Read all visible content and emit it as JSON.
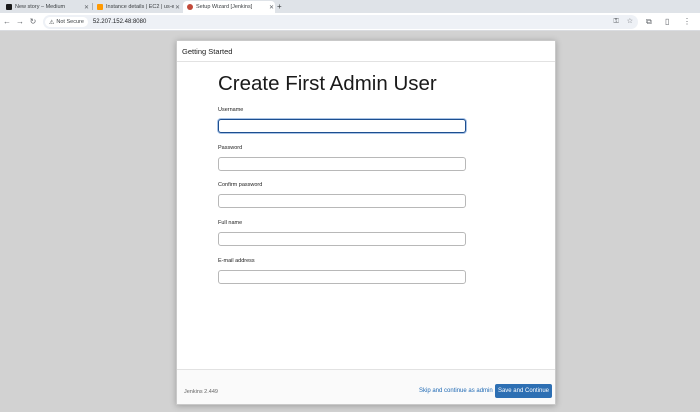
{
  "browser": {
    "tabs": [
      {
        "title": "New story – Medium",
        "favicon_color": "#1a1a1a",
        "active": false
      },
      {
        "title": "Instance details | EC2 | us-e…",
        "favicon_color": "#ff9900",
        "active": false
      },
      {
        "title": "Setup Wizard [Jenkins]",
        "favicon_color": "#c24a3a",
        "active": true
      }
    ],
    "new_tab_icon": "+",
    "security_label": "Not Secure",
    "url": "52.207.152.48:8080"
  },
  "dialog": {
    "header": "Getting Started",
    "title": "Create First Admin User",
    "fields": [
      {
        "label": "Username",
        "value": ""
      },
      {
        "label": "Password",
        "value": ""
      },
      {
        "label": "Confirm password",
        "value": ""
      },
      {
        "label": "Full name",
        "value": ""
      },
      {
        "label": "E-mail address",
        "value": ""
      }
    ],
    "footer": {
      "version": "Jenkins 2.449",
      "skip_label": "Skip and continue as admin",
      "save_label": "Save and Continue"
    }
  },
  "colors": {
    "primary_button": "#2d6fb3",
    "link": "#1d68b3",
    "focus_border": "#1d4e8f"
  }
}
